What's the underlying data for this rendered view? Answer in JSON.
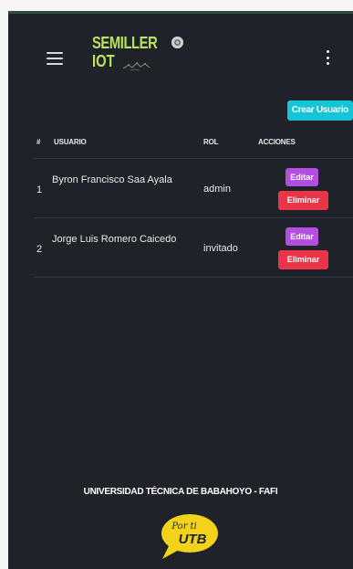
{
  "header": {
    "logo_line1": "SEMILLER",
    "logo_line2": "IOT"
  },
  "toolbar": {
    "create_label": "Crear Usuario"
  },
  "table": {
    "columns": {
      "num": "#",
      "user": "USUARIO",
      "role": "ROL",
      "actions": "ACCIONES"
    },
    "rows": [
      {
        "num": "1",
        "user": "Byron Francisco Saa Ayala",
        "role": "admin",
        "edit": "Editar",
        "delete": "Eliminar"
      },
      {
        "num": "2",
        "user": "Jorge Luis Romero Caicedo",
        "role": "invitado",
        "edit": "Editar",
        "delete": "Eliminar"
      }
    ]
  },
  "footer": {
    "university": "UNIVERSIDAD TÉCNICA DE BABAHOYO - FAFI",
    "utb_tagline": "Por ti",
    "utb_name": "UTB"
  },
  "colors": {
    "background": "#1f2229",
    "logo_green": "#b9e35c",
    "create": "#13c5d7",
    "edit": "#b44ee0",
    "delete": "#ea3447",
    "utb_yellow": "#f3d31a"
  }
}
